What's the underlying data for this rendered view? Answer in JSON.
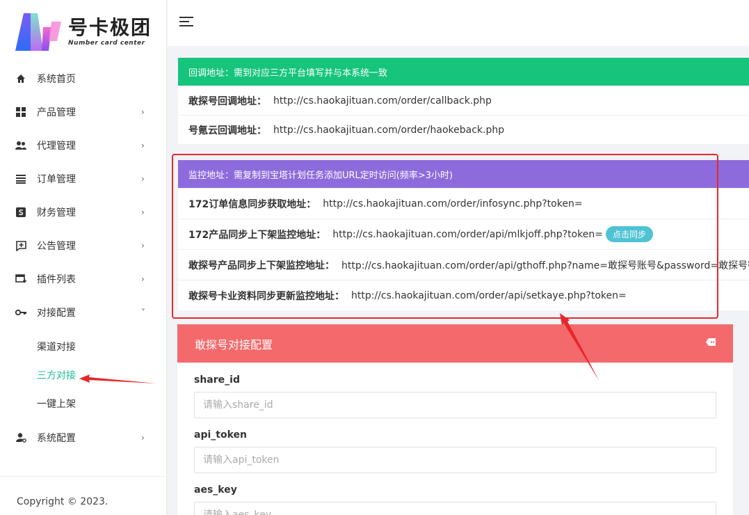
{
  "brand": {
    "title": "号卡极团",
    "subtitle": "Number card center",
    "colors": [
      "#2f6cf6",
      "#b35cf0",
      "#f36bd0",
      "#6ee0c8"
    ]
  },
  "sidebar": {
    "items": [
      {
        "label": "系统首页",
        "icon": "home-icon",
        "has_children": false
      },
      {
        "label": "产品管理",
        "icon": "grid-icon",
        "has_children": true
      },
      {
        "label": "代理管理",
        "icon": "users-icon",
        "has_children": true
      },
      {
        "label": "订单管理",
        "icon": "list-icon",
        "has_children": true
      },
      {
        "label": "财务管理",
        "icon": "dollar-icon",
        "has_children": true
      },
      {
        "label": "公告管理",
        "icon": "announce-icon",
        "has_children": true
      },
      {
        "label": "插件列表",
        "icon": "plugin-icon",
        "has_children": true
      },
      {
        "label": "对接配置",
        "icon": "key-icon",
        "has_children": true,
        "expanded": true
      }
    ],
    "sub_items": [
      {
        "label": "渠道对接",
        "active": false
      },
      {
        "label": "三方对接",
        "active": true
      },
      {
        "label": "一键上架",
        "active": false
      }
    ],
    "last_item": {
      "label": "系统配置",
      "icon": "user-settings-icon"
    },
    "chev_right": "›",
    "chev_down": "˅",
    "active_color": "#1cbb9b",
    "copyright": "Copyright © 2023."
  },
  "callback": {
    "header": "回调地址：需到对应三方平台填写并与本系统一致",
    "rows": [
      {
        "key": "敢探号回调地址：",
        "value": "http://cs.haokajituan.com/order/callback.php"
      },
      {
        "key": "号氪云回调地址：",
        "value": "http://cs.haokajituan.com/order/haokeback.php"
      }
    ]
  },
  "monitor": {
    "header": "监控地址：需复制到宝塔计划任务添加URL定时访问(频率>3小时)",
    "rows": [
      {
        "key": "172订单信息同步获取地址：",
        "value": "http://cs.haokajituan.com/order/infosync.php?token="
      },
      {
        "key": "172产品同步上下架监控地址：",
        "value": "http://cs.haokajituan.com/order/api/mlkjoff.php?token=",
        "button": "点击同步"
      },
      {
        "key": "敢探号产品同步上下架监控地址：",
        "value": "http://cs.haokajituan.com/order/api/gthoff.php?name=敢探号账号&password=敢探号密码"
      },
      {
        "key": "敢探号卡业资料同步更新监控地址：",
        "value": "http://cs.haokajituan.com/order/api/setkaye.php?token="
      }
    ]
  },
  "config": {
    "title": "敢探号对接配置",
    "fields": [
      {
        "label": "share_id",
        "placeholder": "请输入share_id"
      },
      {
        "label": "api_token",
        "placeholder": "请输入api_token"
      },
      {
        "label": "aes_key",
        "placeholder": "请输入aes_key"
      }
    ]
  },
  "colors": {
    "callback_header": "#16c47c",
    "monitor_header": "#8e6bdc",
    "config_header": "#f46a6c",
    "sync_button": "#4fc3d4",
    "annotation": "#e8262b"
  }
}
